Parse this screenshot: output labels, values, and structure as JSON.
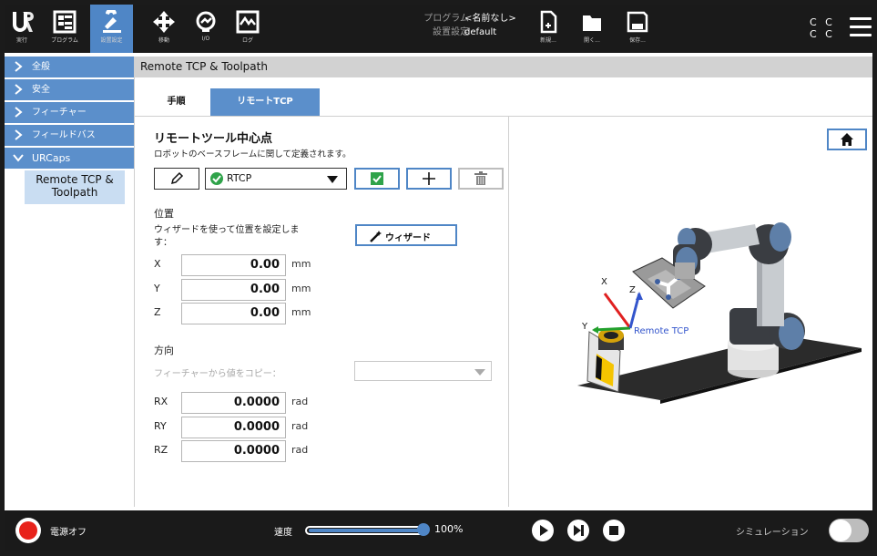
{
  "topbar": {
    "tabs": [
      {
        "id": "run",
        "label": "実行",
        "icon": "ur-logo-icon"
      },
      {
        "id": "program",
        "label": "プログラム",
        "icon": "program-icon"
      },
      {
        "id": "installation",
        "label": "設置設定",
        "icon": "installation-icon",
        "active": true
      },
      {
        "id": "move",
        "label": "移動",
        "icon": "move-arrows-icon"
      },
      {
        "id": "io",
        "label": "I/O",
        "icon": "io-icon"
      },
      {
        "id": "log",
        "label": "ログ",
        "icon": "log-icon"
      }
    ],
    "program_label": "プログラム",
    "program_value": "<名前なし>",
    "installation_label": "設置設定",
    "installation_value": "default",
    "file_buttons": [
      {
        "id": "new",
        "label": "新規...",
        "icon": "new-file-icon"
      },
      {
        "id": "open",
        "label": "開く...",
        "icon": "folder-icon"
      },
      {
        "id": "save",
        "label": "保存...",
        "icon": "save-icon"
      }
    ],
    "cc_line1": "C C",
    "cc_line2": "C C"
  },
  "sidebar": {
    "items": [
      {
        "label": "全般",
        "expanded": false
      },
      {
        "label": "安全",
        "expanded": false
      },
      {
        "label": "フィーチャー",
        "expanded": false
      },
      {
        "label": "フィールドバス",
        "expanded": false
      },
      {
        "label": "URCaps",
        "expanded": true
      }
    ],
    "sub_item": "Remote TCP & Toolpath"
  },
  "page_header": "Remote TCP & Toolpath",
  "tabs": [
    {
      "label": "手順",
      "active": false
    },
    {
      "label": "リモートTCP",
      "active": true
    }
  ],
  "main": {
    "title": "リモートツール中心点",
    "description": "ロボットのベースフレームに関して定義されます。",
    "tcp_select": {
      "value": "RTCP"
    },
    "position": {
      "heading": "位置",
      "wizard_text_1": "ウィザードを使って位置を設定しま",
      "wizard_text_2": "す：",
      "wizard_button": "ウィザード",
      "rows": [
        {
          "axis": "X",
          "value": "0.00",
          "unit": "mm"
        },
        {
          "axis": "Y",
          "value": "0.00",
          "unit": "mm"
        },
        {
          "axis": "Z",
          "value": "0.00",
          "unit": "mm"
        }
      ]
    },
    "orientation": {
      "heading": "方向",
      "copy_label": "フィーチャーから値をコピー：",
      "rows": [
        {
          "axis": "RX",
          "value": "0.0000",
          "unit": "rad"
        },
        {
          "axis": "RY",
          "value": "0.0000",
          "unit": "rad"
        },
        {
          "axis": "RZ",
          "value": "0.0000",
          "unit": "rad"
        }
      ]
    }
  },
  "viewer": {
    "tcp_label": "Remote TCP",
    "axis_x": "X",
    "axis_y": "Y",
    "axis_z": "Z"
  },
  "bottombar": {
    "power_label": "電源オフ",
    "speed_label": "速度",
    "speed_value": "100%",
    "speed_fraction": 1.0,
    "simulation_label": "シミュレーション",
    "colors": {
      "power": "#e8221b",
      "accent": "#4f86c6"
    }
  }
}
